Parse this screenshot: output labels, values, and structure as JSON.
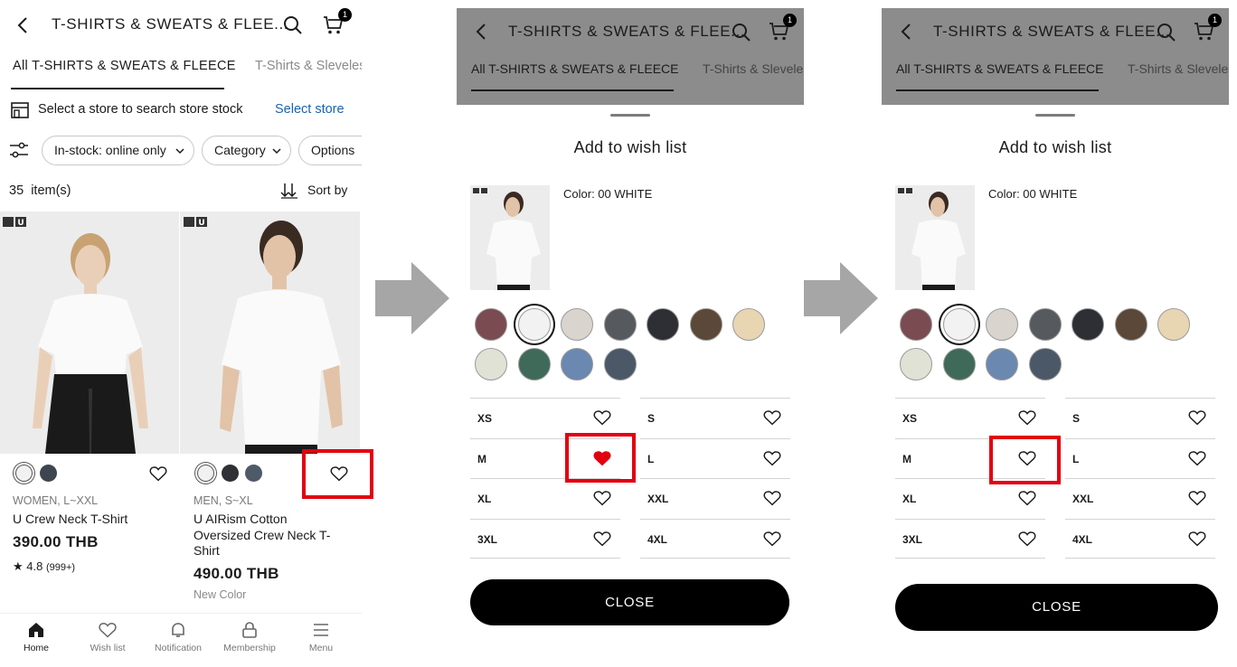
{
  "screen1": {
    "header": {
      "title": "T-SHIRTS & SWEATS & FLEE...",
      "cart_count": "1"
    },
    "tabs": {
      "active": "All T-SHIRTS & SWEATS & FLEECE",
      "next": "T-Shirts & Sleveless"
    },
    "store": {
      "text": "Select a store to search store stock",
      "link": "Select store"
    },
    "filters": {
      "chips": [
        "In-stock: online only",
        "Category",
        "Options"
      ]
    },
    "results": {
      "count": "35",
      "unit": "item(s)",
      "sort_label": "Sort by"
    },
    "products": [
      {
        "badge": "U",
        "meta": "WOMEN, L~XXL",
        "name": "U Crew Neck T-Shirt",
        "price": "390.00 THB",
        "rating": "4.8",
        "reviews": "(999+)",
        "swatches": [
          "#f1f1f1",
          "#3d4650"
        ]
      },
      {
        "badge": "U",
        "meta": "MEN, S~XL",
        "name": "U AIRism Cotton Oversized Crew Neck T-Shirt",
        "price": "490.00 THB",
        "tag": "New Color",
        "swatches": [
          "#f1f1f1",
          "#2e3136",
          "#4f5a68"
        ]
      }
    ],
    "bottom_nav": {
      "home": "Home",
      "wishlist": "Wish list",
      "notification": "Notification",
      "membership": "Membership",
      "menu": "Menu"
    }
  },
  "modal": {
    "header_title": "T-SHIRTS & SWEATS & FLEE...",
    "cart_count": "1",
    "tab_active": "All T-SHIRTS & SWEATS & FLEECE",
    "tab_next": "T-Shirts & Sleveless",
    "title": "Add to wish list",
    "color_label": "Color: 00 WHITE",
    "swatches": [
      "#7a4b50",
      "#f2f2f2",
      "#d9d4cd",
      "#565a5f",
      "#2d2f34",
      "#5c4838",
      "#e8d5b2",
      "#dfe2d4",
      "#3f6a5a",
      "#6a88b0",
      "#4a5868"
    ],
    "selected_swatch": 1,
    "sizes": [
      "XS",
      "S",
      "M",
      "L",
      "XL",
      "XXL",
      "3XL",
      "4XL"
    ],
    "close_label": "CLOSE"
  },
  "colors": {
    "accent_link": "#1a63b0",
    "highlight_red": "#e3000f",
    "heart_filled": "#e3000f",
    "arrow_gray": "#a6a6a6"
  },
  "state": {
    "screen2_favorited_size": "M",
    "screen3_favorited_size": ""
  }
}
